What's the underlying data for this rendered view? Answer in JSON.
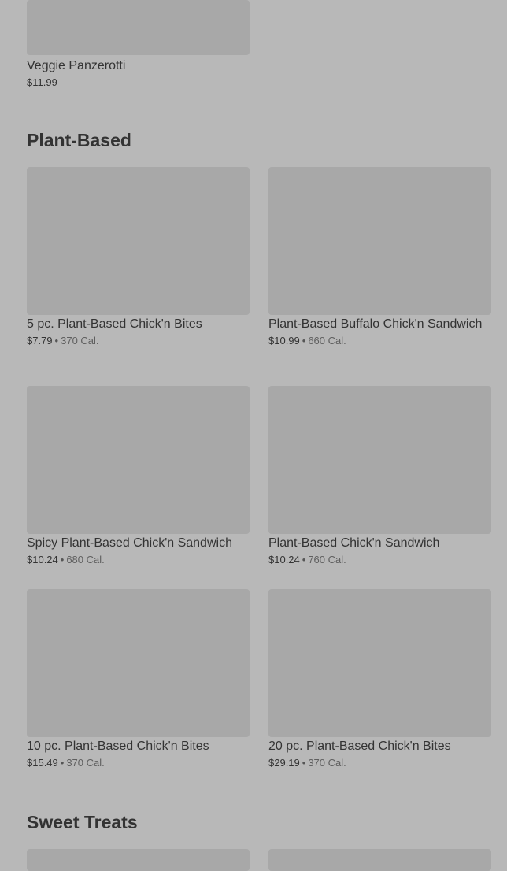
{
  "top_item": {
    "name": "Veggie Panzerotti",
    "price": "$11.99"
  },
  "sections": [
    {
      "title": "Plant-Based",
      "items": [
        {
          "name": "5 pc. Plant-Based Chick'n Bites",
          "price": "$7.79",
          "separator": "•",
          "calories": "370 Cal."
        },
        {
          "name": "Plant-Based Buffalo Chick'n Sandwich",
          "price": "$10.99",
          "separator": "•",
          "calories": "660 Cal."
        },
        {
          "name": "Spicy Plant-Based Chick'n Sandwich",
          "price": "$10.24",
          "separator": "•",
          "calories": "680 Cal."
        },
        {
          "name": "Plant-Based Chick'n Sandwich",
          "price": "$10.24",
          "separator": "•",
          "calories": "760 Cal."
        },
        {
          "name": "10 pc. Plant-Based Chick'n Bites",
          "price": "$15.49",
          "separator": "•",
          "calories": "370 Cal."
        },
        {
          "name": "20 pc. Plant-Based Chick'n Bites",
          "price": "$29.19",
          "separator": "•",
          "calories": "370 Cal."
        }
      ]
    },
    {
      "title": "Sweet Treats",
      "items": []
    }
  ]
}
